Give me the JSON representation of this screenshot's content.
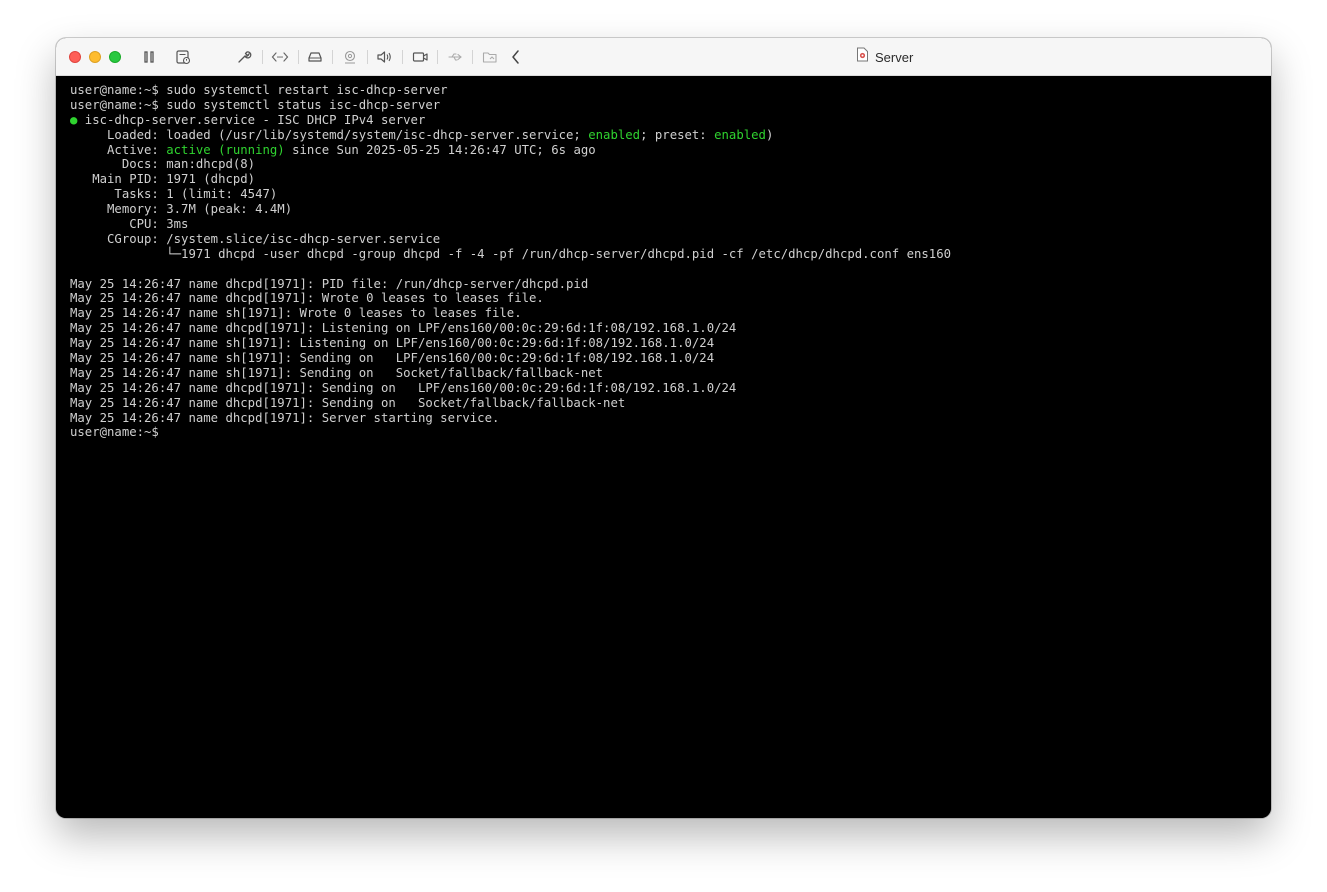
{
  "window": {
    "title": "Server"
  },
  "toolbar": {
    "icons": [
      "pause-icon",
      "snapshot-icon",
      "wrench-icon",
      "code-icon",
      "disk-icon",
      "camera-icon",
      "speaker-icon",
      "display-icon",
      "usb-icon",
      "shared-folder-icon",
      "chevron-left-icon"
    ]
  },
  "colors": {
    "terminal_bg": "#000000",
    "terminal_text": "#d0d0d0",
    "status_green": "#2fd32f"
  },
  "terminal": {
    "cmd1": "user@name:~$ sudo systemctl restart isc-dhcp-server",
    "cmd2": "user@name:~$ sudo systemctl status isc-dhcp-server",
    "status_bullet": "●",
    "status_title": " isc-dhcp-server.service - ISC DHCP IPv4 server",
    "loaded_label": "     Loaded: ",
    "loaded_value": "loaded (/usr/lib/systemd/system/isc-dhcp-server.service; ",
    "loaded_enabled": "enabled",
    "loaded_preset": "; preset: ",
    "loaded_preset_value": "enabled",
    "loaded_close": ")",
    "active_label": "     Active: ",
    "active_value": "active (running)",
    "active_since": " since Sun 2025-05-25 14:26:47 UTC; 6s ago",
    "docs": "       Docs: man:dhcpd(8)",
    "main_pid": "   Main PID: 1971 (dhcpd)",
    "tasks": "      Tasks: 1 (limit: 4547)",
    "memory": "     Memory: 3.7M (peak: 4.4M)",
    "cpu": "        CPU: 3ms",
    "cgroup": "     CGroup: /system.slice/isc-dhcp-server.service",
    "cgroup_child": "             └─1971 dhcpd -user dhcpd -group dhcpd -f -4 -pf /run/dhcp-server/dhcpd.pid -cf /etc/dhcp/dhcpd.conf ens160",
    "log": [
      "May 25 14:26:47 name dhcpd[1971]: PID file: /run/dhcp-server/dhcpd.pid",
      "May 25 14:26:47 name dhcpd[1971]: Wrote 0 leases to leases file.",
      "May 25 14:26:47 name sh[1971]: Wrote 0 leases to leases file.",
      "May 25 14:26:47 name dhcpd[1971]: Listening on LPF/ens160/00:0c:29:6d:1f:08/192.168.1.0/24",
      "May 25 14:26:47 name sh[1971]: Listening on LPF/ens160/00:0c:29:6d:1f:08/192.168.1.0/24",
      "May 25 14:26:47 name sh[1971]: Sending on   LPF/ens160/00:0c:29:6d:1f:08/192.168.1.0/24",
      "May 25 14:26:47 name sh[1971]: Sending on   Socket/fallback/fallback-net",
      "May 25 14:26:47 name dhcpd[1971]: Sending on   LPF/ens160/00:0c:29:6d:1f:08/192.168.1.0/24",
      "May 25 14:26:47 name dhcpd[1971]: Sending on   Socket/fallback/fallback-net",
      "May 25 14:26:47 name dhcpd[1971]: Server starting service."
    ],
    "prompt": "user@name:~$"
  }
}
